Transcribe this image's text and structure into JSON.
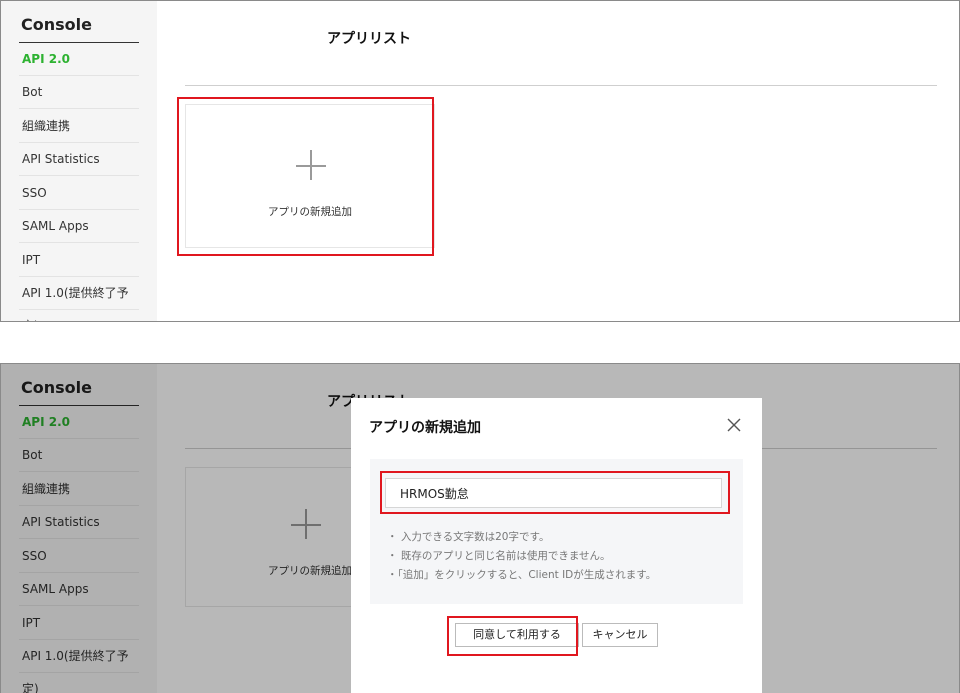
{
  "sidebar": {
    "brand": "Console",
    "items": [
      {
        "label": "API 2.0",
        "active": true
      },
      {
        "label": "Bot"
      },
      {
        "label": "組織連携"
      },
      {
        "label": "API Statistics"
      },
      {
        "label": "SSO"
      },
      {
        "label": "SAML Apps"
      },
      {
        "label": "IPT"
      },
      {
        "label": "API 1.0(提供終了予定)"
      }
    ]
  },
  "main": {
    "title": "アプリリスト",
    "add_card_label": "アプリの新規追加"
  },
  "modal": {
    "title": "アプリの新規追加",
    "input_value": "HRMOS勤怠",
    "notes": [
      "・ 入力できる文字数は20字です。",
      "・ 既存のアプリと同じ名前は使用できません。",
      "・「追加」をクリックすると、Client IDが生成されます。"
    ],
    "agree_button": "同意して利用する",
    "cancel_button": "キャンセル"
  },
  "colors": {
    "accent_green": "#2db231",
    "highlight_red": "#e0171f"
  }
}
